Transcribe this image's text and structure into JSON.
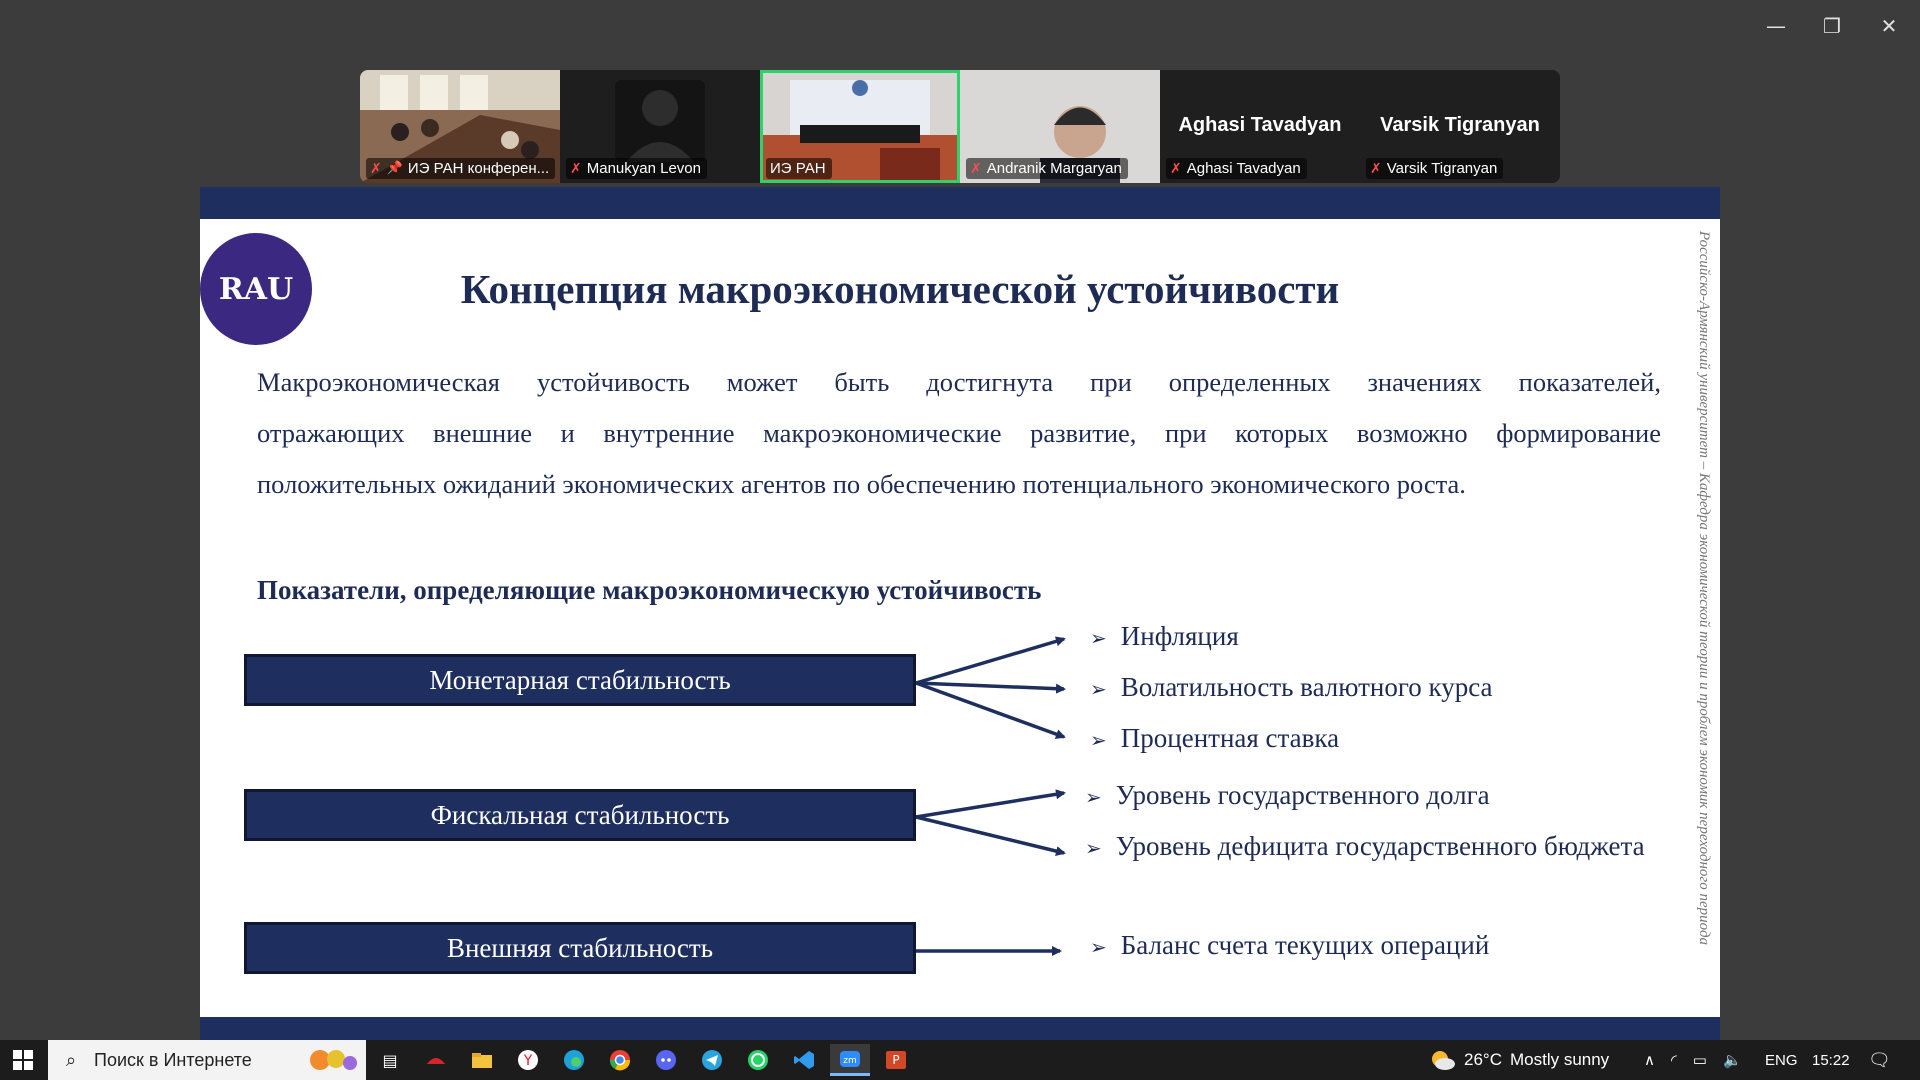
{
  "window": {
    "minimize_icon": "—",
    "restore_icon": "❐",
    "close_icon": "✕"
  },
  "participants": [
    {
      "name": "ИЭ РАН конферен...",
      "muted": true,
      "pinned": true,
      "video": "conference-room"
    },
    {
      "name": "Manukyan Levon",
      "muted": true,
      "video": "avatar"
    },
    {
      "name": "ИЭ РАН",
      "muted": false,
      "active": true,
      "video": "hall"
    },
    {
      "name": "Andranik Margaryan",
      "muted": true,
      "video": "person"
    },
    {
      "name": "Aghasi Tavadyan",
      "display_name": "Aghasi Tavadyan",
      "muted": true,
      "video": "none"
    },
    {
      "name": "Varsik Tigranyan",
      "display_name": "Varsik Tigranyan",
      "muted": true,
      "video": "none"
    }
  ],
  "slide": {
    "logo_text": "RAU",
    "title": "Концепция макроэкономической устойчивости",
    "paragraph_lines": [
      "Макроэкономическая устойчивость может быть достигнута при определенных значениях показателей,",
      "отражающих внешние и внутренние макроэкономические развитие, при которых возможно формирование",
      "положительных ожиданий экономических  агентов по обеспечению потенциального экономического роста."
    ],
    "subheading": "Показатели, определяющие макроэкономическую устойчивость",
    "groups": [
      {
        "label": "Монетарная стабильность",
        "items": [
          "Инфляция",
          "Волатильность валютного курса",
          "Процентная ставка"
        ]
      },
      {
        "label": "Фискальная стабильность",
        "items": [
          "Уровень государственного долга",
          "Уровень дефицита государственного бюджета"
        ]
      },
      {
        "label": "Внешняя стабильность",
        "items": [
          "Баланс счета текущих операций"
        ]
      }
    ],
    "bullet_marker": "➢",
    "side_text": "Российско-Армянский университет – Кафедра экономической теории и проблем экономик переходного периода",
    "colors": {
      "navy": "#1e2e5e",
      "text": "#1e2b55",
      "logo": "#3b2880"
    }
  },
  "taskbar": {
    "search_placeholder": "Поиск в Интернете",
    "weather_temp": "26°C",
    "weather_text": "Mostly sunny",
    "language": "ENG",
    "time": "15:22",
    "apps": [
      "task-view-icon",
      "app-red-icon",
      "file-explorer-icon",
      "yandex-browser-icon",
      "edge-icon",
      "chrome-icon",
      "discord-icon",
      "telegram-icon",
      "whatsapp-icon",
      "vscode-icon",
      "zoom-icon",
      "powerpoint-icon"
    ]
  }
}
